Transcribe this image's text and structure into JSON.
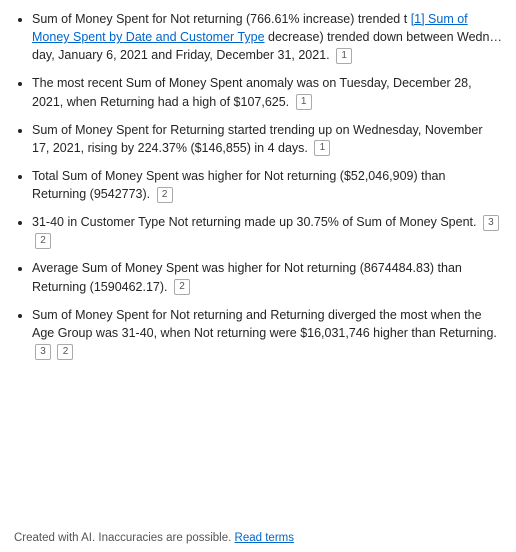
{
  "bullets": [
    {
      "text": "Sum of Money Spent for Not returning (766.61% increase) trended t",
      "link": {
        "label": "[1] Sum of Money Spent by Date and Customer Type",
        "href": "#"
      },
      "text_after": "decrease) trended down between Wedn…day, January 6, 2021 and Friday, December 31, 2021.",
      "badges": [
        "1"
      ]
    },
    {
      "text": "The most recent Sum of Money Spent anomaly was on Tuesday, December 28, 2021, when Returning had a high of $107,625.",
      "badges": [
        "1"
      ]
    },
    {
      "text": "Sum of Money Spent for Returning started trending up on Wednesday, November 17, 2021, rising by 224.37% ($146,855) in 4 days.",
      "badges": [
        "1"
      ]
    },
    {
      "text": "Total Sum of Money Spent was higher for Not returning ($52,046,909) than Returning (9542773).",
      "badges": [
        "2"
      ]
    },
    {
      "text": "31-40 in Customer Type Not returning made up 30.75% of Sum of Money Spent.",
      "badges": [
        "3",
        "2"
      ]
    },
    {
      "text": "Average Sum of Money Spent was higher for Not returning (8674484.83) than Returning (1590462.17).",
      "badges": [
        "2"
      ]
    },
    {
      "text": "Sum of Money Spent for Not returning and Returning diverged the most when the Age Group was 31-40, when Not returning were $16,031,746 higher than Returning.",
      "badges": [
        "3",
        "2"
      ]
    }
  ],
  "footer": {
    "text": "Created with AI. Inaccuracies are possible.",
    "link_label": "Read terms"
  }
}
